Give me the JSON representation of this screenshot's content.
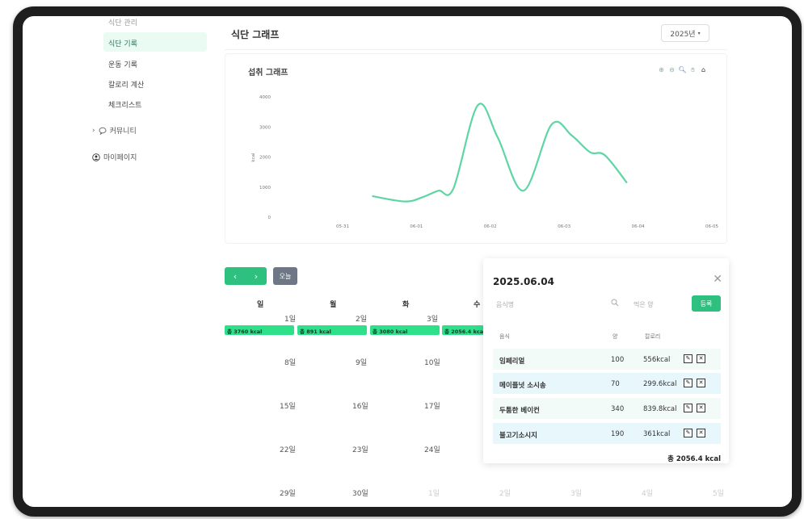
{
  "sidebar": {
    "cut_item": "식단 관리",
    "items": [
      {
        "label": "식단 기록",
        "active": true
      },
      {
        "label": "운동 기록",
        "active": false
      },
      {
        "label": "칼로리 계산",
        "active": false
      },
      {
        "label": "체크리스트",
        "active": false
      }
    ],
    "community": "커뮤니티",
    "mypage": "마이페이지"
  },
  "header": {
    "title": "식단 그래프",
    "year": "2025년"
  },
  "chart": {
    "title": "섭취 그래프"
  },
  "chart_data": {
    "type": "line",
    "title": "섭취 그래프",
    "ylabel": "kcal",
    "x": [
      "05-31",
      "06-01",
      "06-02",
      "06-03",
      "06-04",
      "06-05"
    ],
    "y_ticks": [
      0,
      1000,
      2000,
      3000,
      4000
    ],
    "ylim": [
      0,
      4000
    ],
    "series": [
      {
        "color": "#5ed6a4",
        "points": [
          {
            "x": 5.4,
            "y": 700
          },
          {
            "x": 5.85,
            "y": 520
          },
          {
            "x": 6.1,
            "y": 680
          },
          {
            "x": 6.3,
            "y": 880
          },
          {
            "x": 6.5,
            "y": 950
          },
          {
            "x": 6.83,
            "y": 3720
          },
          {
            "x": 7.1,
            "y": 2650
          },
          {
            "x": 7.45,
            "y": 880
          },
          {
            "x": 7.83,
            "y": 3080
          },
          {
            "x": 8.1,
            "y": 2720
          },
          {
            "x": 8.35,
            "y": 2160
          },
          {
            "x": 8.55,
            "y": 2060
          },
          {
            "x": 8.85,
            "y": 1140
          }
        ]
      }
    ]
  },
  "calendar": {
    "today": "오늘",
    "weekdays": [
      "일",
      "월",
      "화",
      "수"
    ],
    "weeks": [
      [
        "1일",
        "2일",
        "3일"
      ],
      [
        "8일",
        "9일",
        "10일"
      ],
      [
        "15일",
        "16일",
        "17일"
      ],
      [
        "22일",
        "23일",
        "24일"
      ],
      [
        "29일",
        "30일",
        "1일",
        "2일",
        "3일",
        "4일",
        "5일"
      ]
    ],
    "kcal_bars": [
      "총 3760 kcal",
      "총 891 kcal",
      "총 3080 kcal",
      "총 2056.4 kcal"
    ]
  },
  "modal": {
    "date": "2025.06.04",
    "food_placeholder": "음식명",
    "amount_placeholder": "먹은 양",
    "register": "등록",
    "headers": [
      "음식",
      "양",
      "칼로리"
    ],
    "rows": [
      {
        "food": "임페리얼",
        "amount": "100",
        "kcal": "556kcal"
      },
      {
        "food": "메이플넛 소시송",
        "amount": "70",
        "kcal": "299.6kcal"
      },
      {
        "food": "두툼한 베이컨",
        "amount": "340",
        "kcal": "839.8kcal"
      },
      {
        "food": "불고기소시지",
        "amount": "190",
        "kcal": "361kcal"
      }
    ],
    "total": "총 2056.4 kcal"
  }
}
